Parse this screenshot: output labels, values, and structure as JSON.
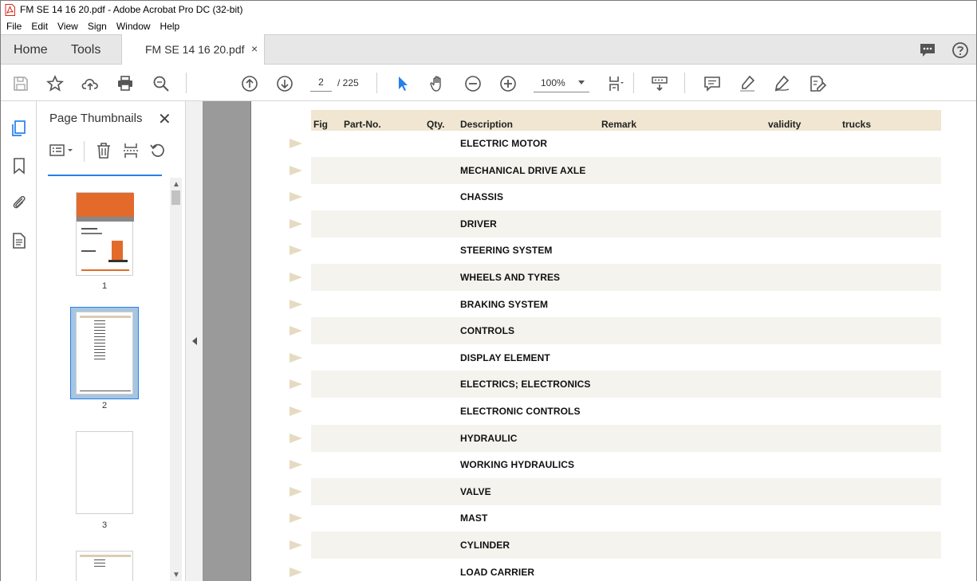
{
  "window": {
    "title": "FM SE 14 16 20.pdf - Adobe Acrobat Pro DC (32-bit)"
  },
  "menu": [
    "File",
    "Edit",
    "View",
    "Sign",
    "Window",
    "Help"
  ],
  "tabs": {
    "home": "Home",
    "tools": "Tools",
    "document": "FM SE 14 16 20.pdf",
    "close": "×"
  },
  "toolbar": {
    "page_current": "2",
    "page_total": "/  225",
    "zoom": "100%"
  },
  "thumbnails": {
    "title": "Page Thumbnails",
    "close": "✕",
    "pages": [
      "1",
      "2",
      "3"
    ],
    "selected_page": "2"
  },
  "table": {
    "headers": {
      "fig": "Fig",
      "part_no": "Part-No.",
      "qty": "Qty.",
      "description": "Description",
      "remark": "Remark",
      "validity": "validity",
      "trucks": "trucks"
    },
    "rows": [
      "ELECTRIC MOTOR",
      "MECHANICAL DRIVE AXLE",
      "CHASSIS",
      "DRIVER",
      "STEERING SYSTEM",
      "WHEELS AND TYRES",
      "BRAKING SYSTEM",
      "CONTROLS",
      "DISPLAY ELEMENT",
      "ELECTRICS; ELECTRONICS",
      "ELECTRONIC CONTROLS",
      "HYDRAULIC",
      "WORKING HYDRAULICS",
      "VALVE",
      "MAST",
      "CYLINDER",
      "LOAD CARRIER"
    ]
  },
  "colors": {
    "accent": "#2680eb",
    "header_band": "#f0e6d1",
    "row_shade": "#f4f3ee",
    "row_marker": "#e6dbc2",
    "pdf_icon": "#d9261c"
  }
}
